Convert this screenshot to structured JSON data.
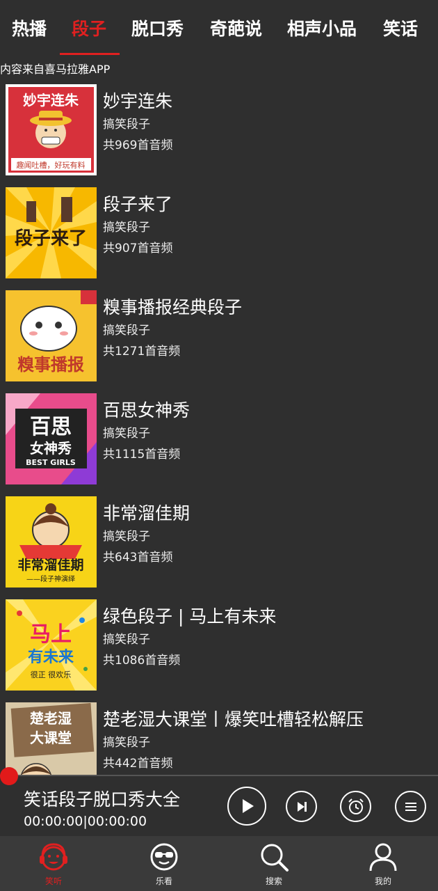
{
  "tabs": [
    {
      "label": "热播"
    },
    {
      "label": "段子"
    },
    {
      "label": "脱口秀"
    },
    {
      "label": "奇葩说"
    },
    {
      "label": "相声小品"
    },
    {
      "label": "笑话"
    }
  ],
  "active_tab_index": 1,
  "source_note": "内容来自喜马拉雅APP",
  "items": [
    {
      "title": "妙宇连朱",
      "category": "搞笑段子",
      "count": "共969首音频",
      "cover_text": "妙宇连朱",
      "cover_sub": "趣闻吐槽，好玩有料"
    },
    {
      "title": "段子来了",
      "category": "搞笑段子",
      "count": "共907首音频",
      "cover_text": "段子来了"
    },
    {
      "title": "糗事播报经典段子",
      "category": "搞笑段子",
      "count": "共1271首音频",
      "cover_text": "糗事播报"
    },
    {
      "title": "百思女神秀",
      "category": "搞笑段子",
      "count": "共1115首音频",
      "cover_text": "百思",
      "cover_text2": "女神秀",
      "cover_sub": "BEST GIRLS"
    },
    {
      "title": "非常溜佳期",
      "category": "搞笑段子",
      "count": "共643首音频",
      "cover_text": "非常溜佳期",
      "cover_sub": "——段子神演绎"
    },
    {
      "title": "绿色段子 | 马上有未来",
      "category": "搞笑段子",
      "count": "共1086首音频",
      "cover_text": "马上",
      "cover_text2": "有未来",
      "cover_sub": "很正 很欢乐"
    },
    {
      "title": "楚老湿大课堂丨爆笑吐槽轻松解压",
      "category": "搞笑段子",
      "count": "共442首音频",
      "cover_text": "楚老湿",
      "cover_text2": "大课堂"
    }
  ],
  "player": {
    "title": "笑话段子脱口秀大全",
    "time": "00:00:00|00:00:00"
  },
  "bottom_nav": [
    {
      "label": "笑听",
      "icon": "headphones-face-icon"
    },
    {
      "label": "乐看",
      "icon": "sunglasses-face-icon"
    },
    {
      "label": "搜索",
      "icon": "search-icon"
    },
    {
      "label": "我的",
      "icon": "user-icon"
    }
  ],
  "colors": {
    "accent": "#e02020",
    "background": "#2f2f2f",
    "nav_background": "#3a3a3a"
  }
}
